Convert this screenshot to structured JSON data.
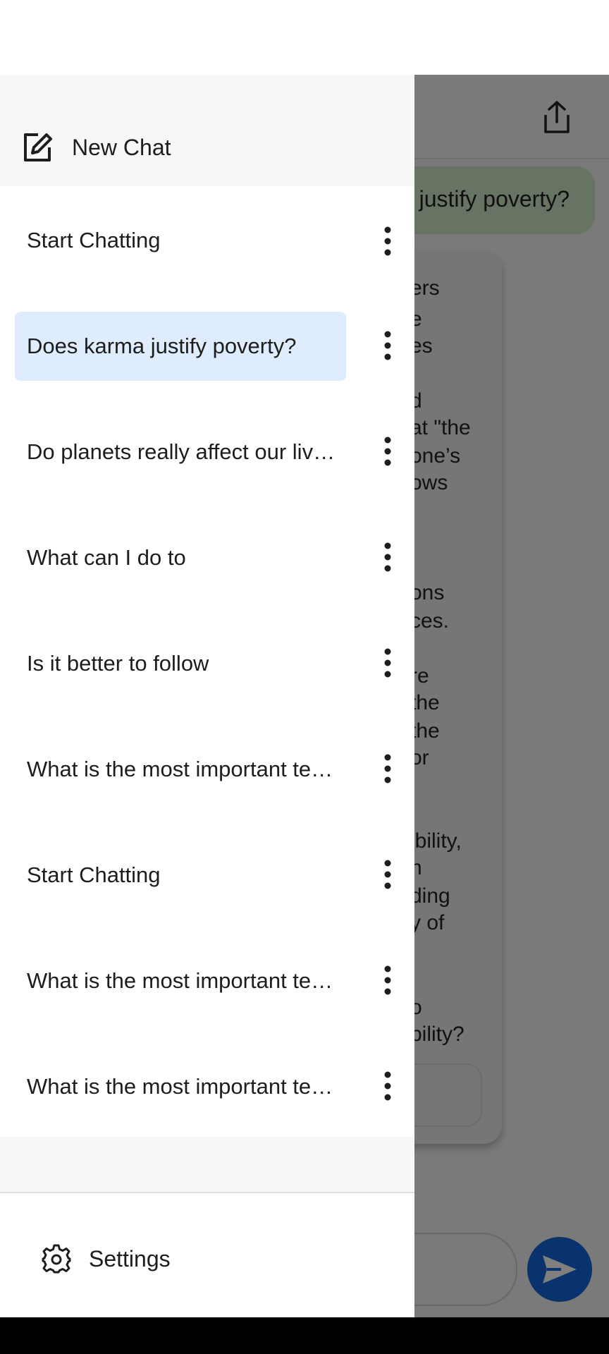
{
  "background_chat": {
    "user_message": "justify poverty?",
    "bot_lines": [
      "ers",
      "e",
      "es",
      "d",
      "at \"the",
      "one’s",
      "ows",
      "ons",
      "ces.",
      "re",
      "the",
      "the",
      "or",
      "ibility,",
      "n",
      "ding",
      "y of",
      "o",
      "bility?"
    ]
  },
  "drawer": {
    "new_chat_label": "New Chat",
    "chats": [
      {
        "title": "Start Chatting"
      },
      {
        "title": "Does karma justify poverty?"
      },
      {
        "title": "Do planets really affect our lives?"
      },
      {
        "title": "What can I do to"
      },
      {
        "title": "Is it better to follow"
      },
      {
        "title": "What is the most important teaching?"
      },
      {
        "title": "Start Chatting"
      },
      {
        "title": "What is the most important teaching?"
      },
      {
        "title": "What is the most important teaching?"
      }
    ],
    "settings_label": "Settings"
  },
  "colors": {
    "selected_item": "#deecfd",
    "send_button": "#1565d8",
    "user_bubble": "#cfe6c7"
  }
}
